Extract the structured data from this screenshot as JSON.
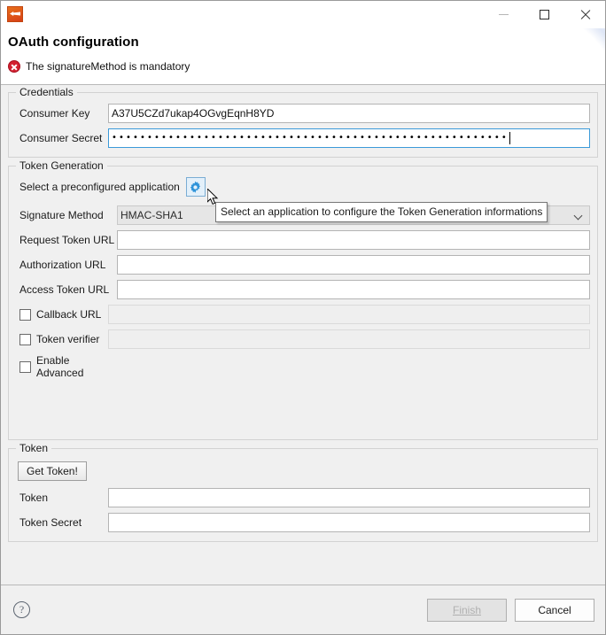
{
  "window": {
    "app_icon": "talend-app-icon",
    "minimize_label": "minimize",
    "maximize_label": "maximize",
    "close_label": "close"
  },
  "header": {
    "title": "OAuth configuration",
    "message": "The signatureMethod is mandatory",
    "message_icon": "error-icon",
    "message_color": "#d32030"
  },
  "credentials": {
    "group_title": "Credentials",
    "consumer_key_label": "Consumer Key",
    "consumer_key_value": "A37U5CZd7ukap4OGvgEqnH8YD",
    "consumer_secret_label": "Consumer Secret",
    "consumer_secret_masked": "••••••••••••••••••••••••••••••••••••••••••••••••••••••••"
  },
  "token_generation": {
    "group_title": "Token Generation",
    "preconfigured_label": "Select a preconfigured application",
    "preconfigured_icon": "gear-icon",
    "tooltip_text": "Select an application to configure the Token Generation informations",
    "signature_method_label": "Signature Method",
    "signature_method_value": "HMAC-SHA1",
    "request_token_url_label": "Request Token URL",
    "request_token_url_value": "",
    "authorization_url_label": "Authorization URL",
    "authorization_url_value": "",
    "access_token_url_label": "Access Token URL",
    "access_token_url_value": "",
    "callback_url_label": "Callback URL",
    "callback_url_value": "",
    "token_verifier_label": "Token verifier",
    "token_verifier_value": "",
    "enable_advanced_label": "Enable Advanced"
  },
  "token": {
    "group_title": "Token",
    "get_token_label": "Get Token!",
    "token_label": "Token",
    "token_value": "",
    "token_secret_label": "Token Secret",
    "token_secret_value": ""
  },
  "footer": {
    "help_icon": "help-icon",
    "help_glyph": "?",
    "finish_label": "Finish",
    "cancel_label": "Cancel"
  }
}
